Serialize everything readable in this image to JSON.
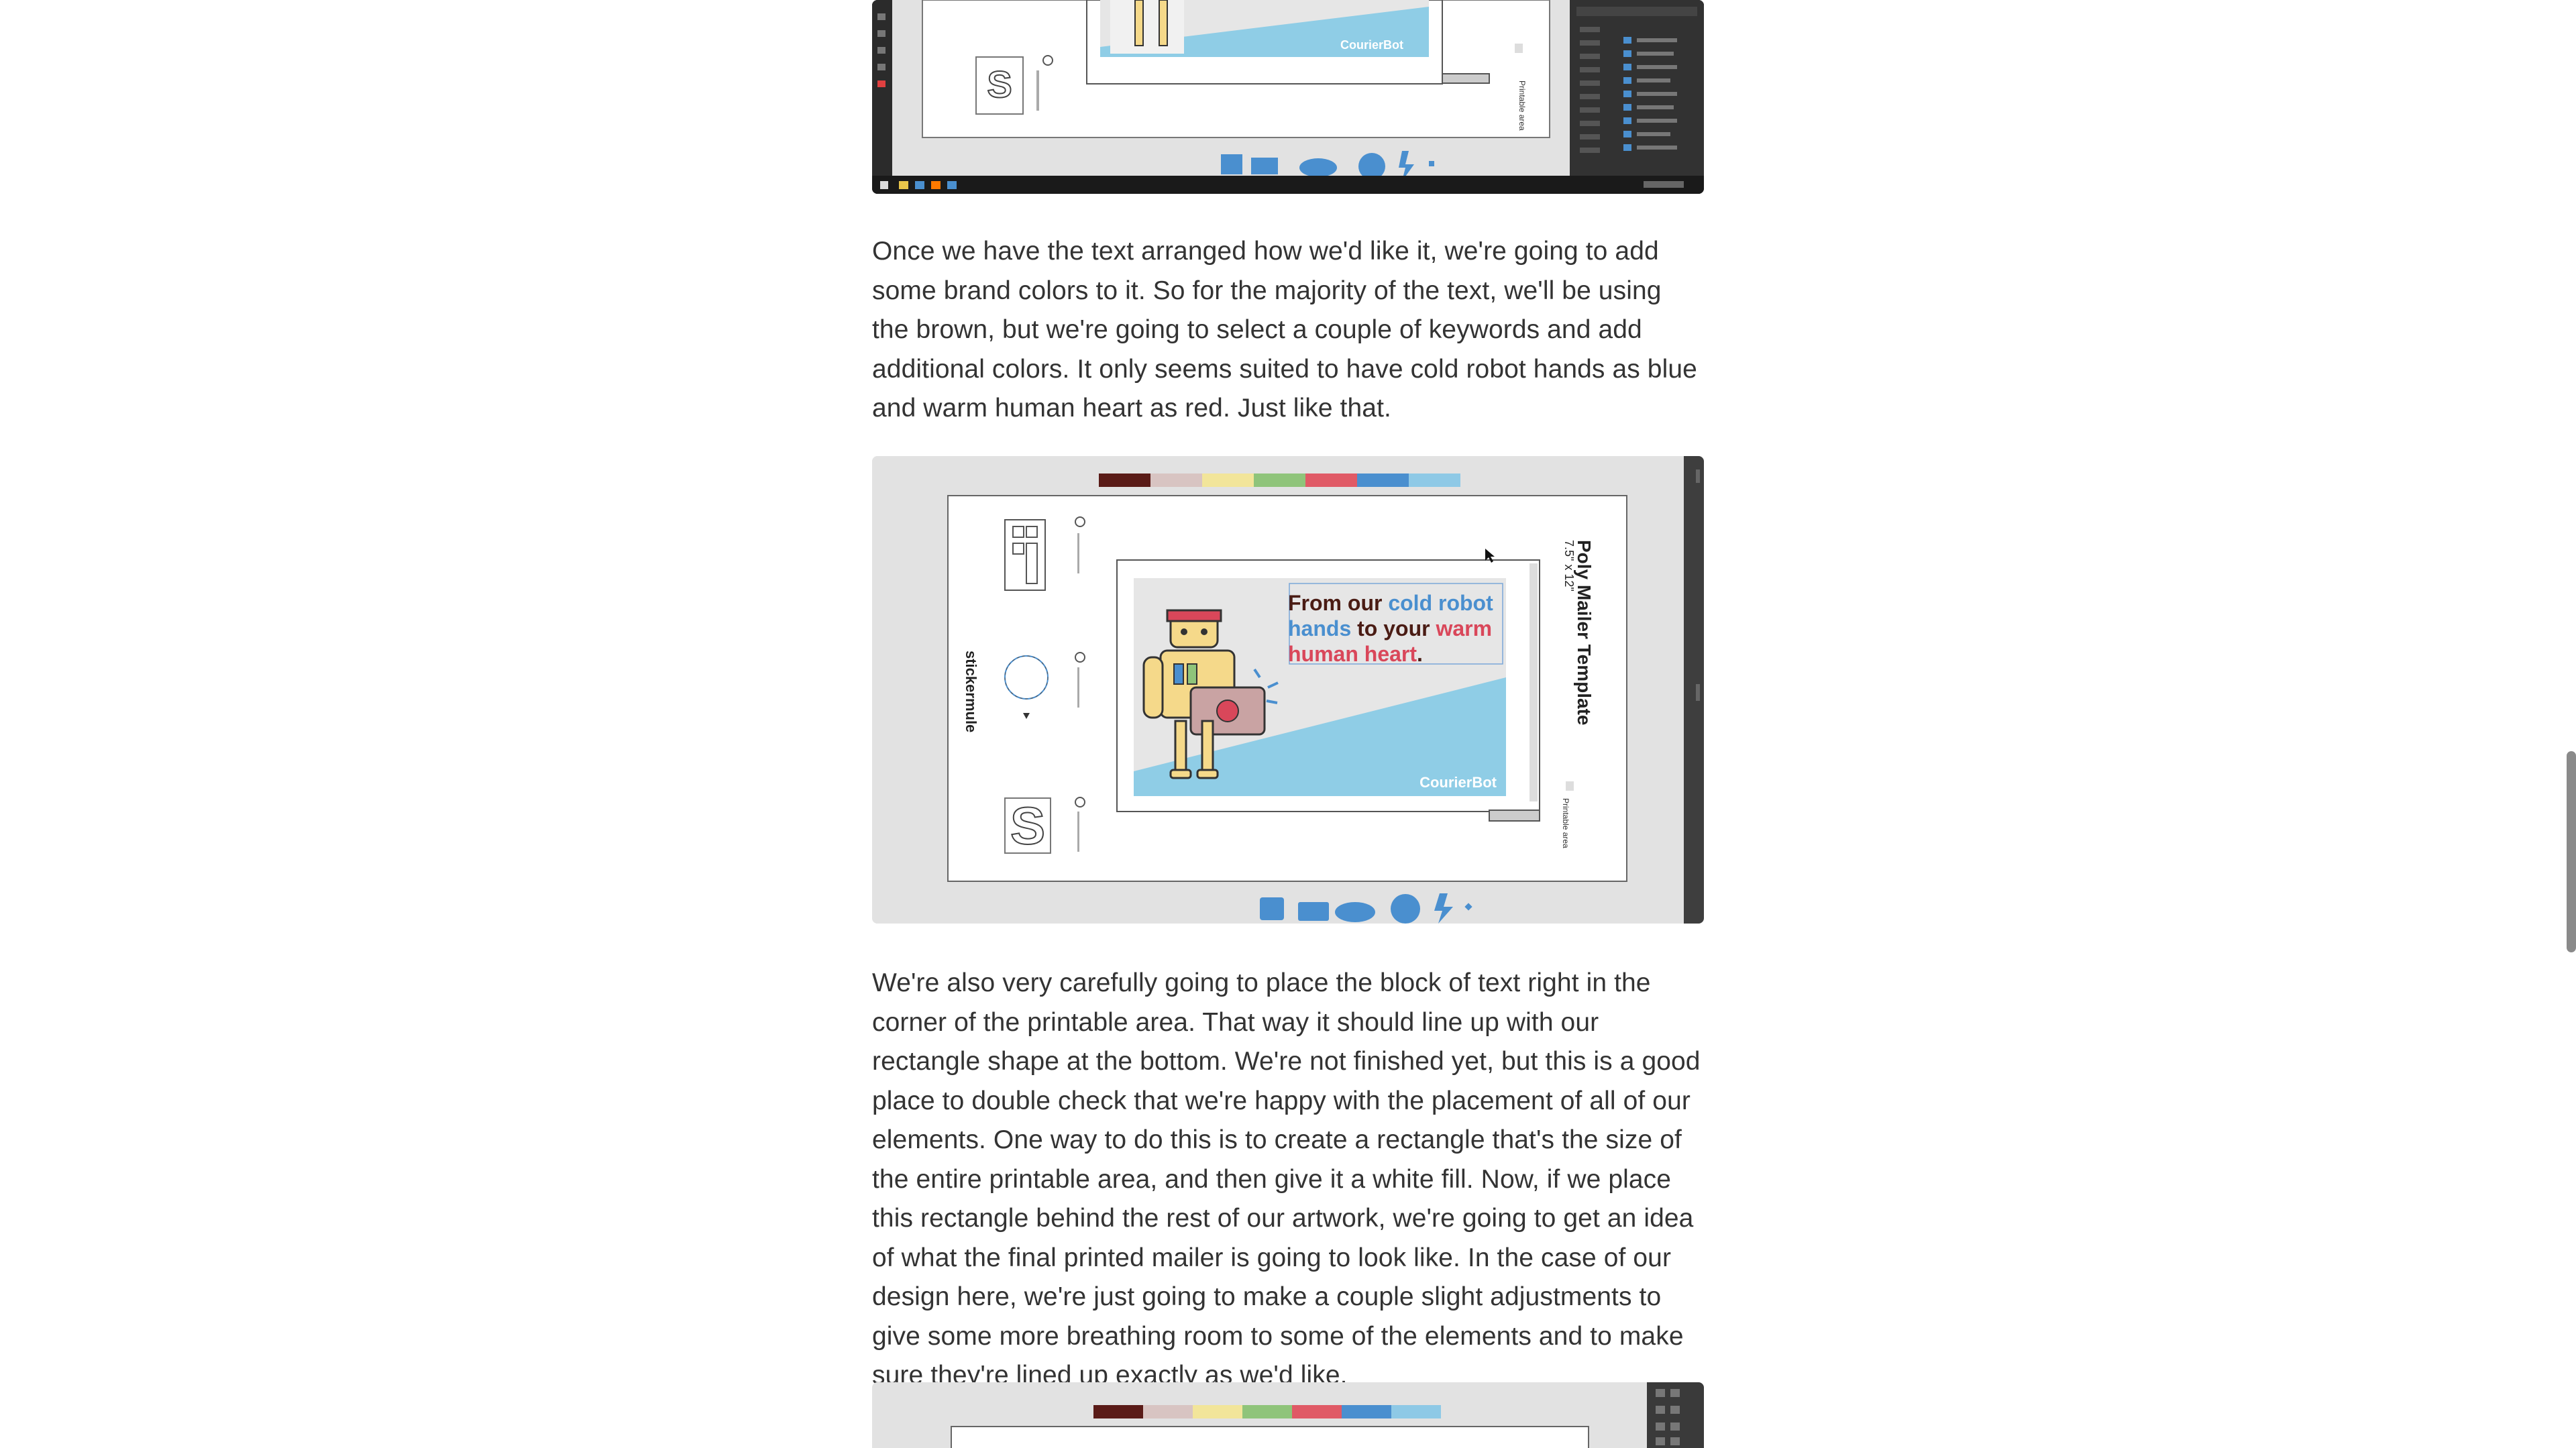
{
  "article": {
    "paragraph_1": "Once we have the text arranged how we'd like it, we're going to add some brand colors to it. So for the majority of the text, we'll be using the brown, but we're going to select a couple of keywords and add additional colors. It only seems suited to have cold robot hands as blue and warm human heart as red. Just like that.",
    "paragraph_2": "We're also very carefully going to place the block of text right in the corner of the printable area. That way it should line up with our rectangle shape at the bottom. We're not finished yet, but this is a good place to double check that we're happy with the placement of all of our elements. One way to do this is to create a rectangle that's the size of the entire printable area, and then give it a white fill. Now, if we place this rectangle behind the rest of our artwork, we're going to get an idea of what the final printed mailer is going to look like. In the case of our design here, we're just going to make a couple slight adjustments to give some more breathing room to some of the elements and to make sure they're lined up exactly as we'd like."
  },
  "screenshot_1": {
    "brand_label": "CourierBot",
    "side_label": "Printable area"
  },
  "screenshot_2": {
    "mailer_text_1": "From our ",
    "mailer_text_blue_1": "cold robot",
    "mailer_text_blue_2": "hands",
    "mailer_text_2": " to your ",
    "mailer_text_red_1": "warm",
    "mailer_text_red_2": "human heart",
    "mailer_text_3": ".",
    "brand_label": "CourierBot",
    "template_title": "Poly Mailer Template",
    "template_size": "7.5\" x 12\"",
    "side_label": "Printable area",
    "logo_text": "stickermule"
  },
  "palette": [
    "#5a1b17",
    "#d8c4c2",
    "#f2e59a",
    "#8fc47a",
    "#e05a66",
    "#4a8fcf",
    "#8ec9e6"
  ],
  "colors": {
    "brown": "#4a1c14",
    "blue": "#4a8fcf",
    "red": "#d9475a",
    "light_blue_area": "#8fcde6"
  }
}
